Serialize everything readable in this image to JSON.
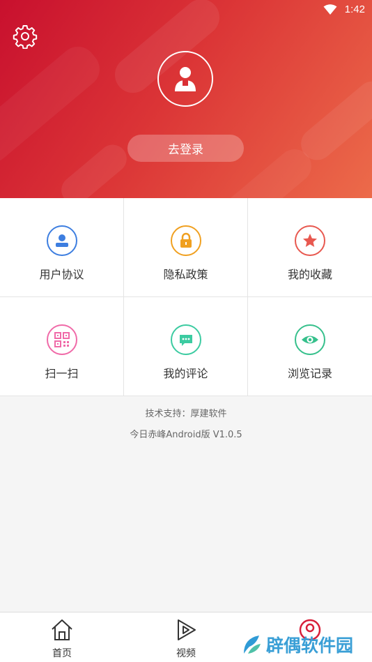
{
  "status_bar": {
    "time": "1:42"
  },
  "header": {
    "login_label": "去登录"
  },
  "grid": {
    "items": [
      {
        "label": "用户协议",
        "color": "#3d7ee0",
        "icon": "user-badge-icon"
      },
      {
        "label": "隐私政策",
        "color": "#f0a020",
        "icon": "lock-icon"
      },
      {
        "label": "我的收藏",
        "color": "#e8584f",
        "icon": "star-icon"
      },
      {
        "label": "扫一扫",
        "color": "#f06aa8",
        "icon": "qr-code-icon"
      },
      {
        "label": "我的评论",
        "color": "#3ccba1",
        "icon": "comment-icon"
      },
      {
        "label": "浏览记录",
        "color": "#36c08c",
        "icon": "eye-icon"
      }
    ]
  },
  "info": {
    "support": "技术支持：厚建软件",
    "version": "今日赤峰Android版 V1.0.5"
  },
  "bottom_nav": {
    "items": [
      {
        "label": "首页",
        "icon": "home-icon"
      },
      {
        "label": "视频",
        "icon": "play-icon"
      },
      {
        "label": "",
        "icon": "profile-icon"
      }
    ]
  },
  "watermark": {
    "text": "辟偶软件园"
  }
}
